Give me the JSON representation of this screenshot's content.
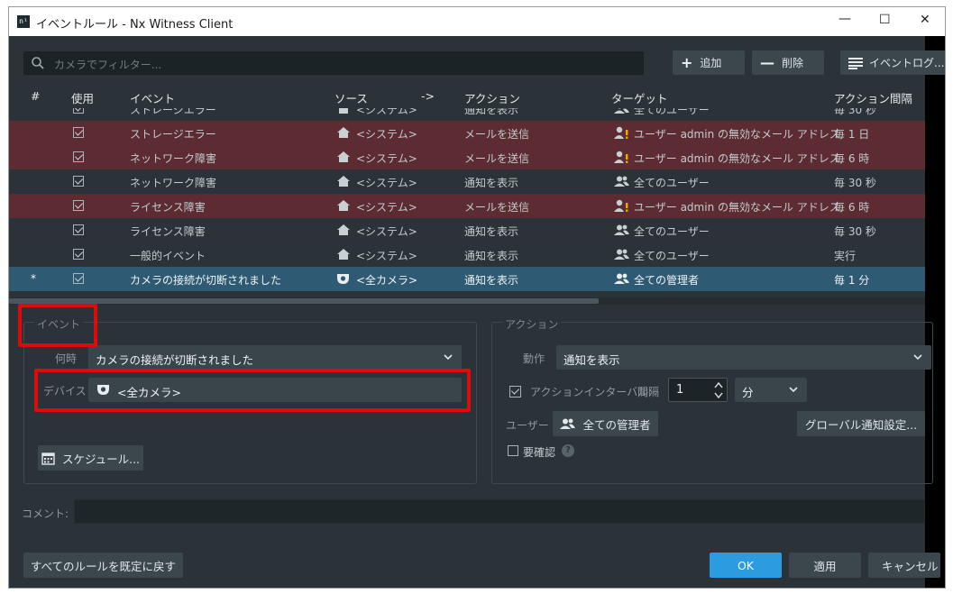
{
  "window": {
    "title": "イベントルール - Nx Witness Client",
    "app_icon": "n¹"
  },
  "toolbar": {
    "filter_placeholder": "カメラでフィルター...",
    "add_label": "追加",
    "delete_label": "削除",
    "eventlog_label": "イベントログ..."
  },
  "table": {
    "headers": {
      "num": "#",
      "use": "使用",
      "event": "イベント",
      "source": "ソース",
      "arrow": "->",
      "action": "アクション",
      "target": "ターゲット",
      "interval": "アクション間隔"
    },
    "rows": [
      {
        "mark": "",
        "event": "ストレージエラー",
        "source": "<システム>",
        "action": "通知を表示",
        "target": "全てのユーザー",
        "interval": "毎 30 秒",
        "state": "normal",
        "source_icon": "home-icon",
        "target_icon": "users-icon"
      },
      {
        "mark": "",
        "event": "ストレージエラー",
        "source": "<システム>",
        "action": "メールを送信",
        "target": "ユーザー admin の無効なメール アドレス",
        "interval": "毎 1 日",
        "state": "warn",
        "source_icon": "home-icon",
        "target_icon": "user-warning-icon"
      },
      {
        "mark": "",
        "event": "ネットワーク障害",
        "source": "<システム>",
        "action": "メールを送信",
        "target": "ユーザー admin の無効なメール アドレス",
        "interval": "毎 6 時",
        "state": "warn",
        "source_icon": "home-icon",
        "target_icon": "user-warning-icon"
      },
      {
        "mark": "",
        "event": "ネットワーク障害",
        "source": "<システム>",
        "action": "通知を表示",
        "target": "全てのユーザー",
        "interval": "毎 30 秒",
        "state": "normal",
        "source_icon": "home-icon",
        "target_icon": "users-icon"
      },
      {
        "mark": "",
        "event": "ライセンス障害",
        "source": "<システム>",
        "action": "メールを送信",
        "target": "ユーザー admin の無効なメール アドレス",
        "interval": "毎 6 時",
        "state": "warn",
        "source_icon": "home-icon",
        "target_icon": "user-warning-icon"
      },
      {
        "mark": "",
        "event": "ライセンス障害",
        "source": "<システム>",
        "action": "通知を表示",
        "target": "全てのユーザー",
        "interval": "毎 30 秒",
        "state": "normal",
        "source_icon": "home-icon",
        "target_icon": "users-icon"
      },
      {
        "mark": "",
        "event": "一般的イベント",
        "source": "<システム>",
        "action": "通知を表示",
        "target": "全てのユーザー",
        "interval": "実行",
        "state": "normal",
        "source_icon": "home-icon",
        "target_icon": "users-icon"
      },
      {
        "mark": "*",
        "event": "カメラの接続が切断されました",
        "source": "<全カメラ>",
        "action": "通知を表示",
        "target": "全ての管理者",
        "interval": "毎 1 分",
        "state": "selected",
        "source_icon": "camera-icon",
        "target_icon": "users-icon"
      }
    ]
  },
  "event_panel": {
    "group_label": "イベント",
    "when_label": "何時",
    "when_value": "カメラの接続が切断されました",
    "device_label": "デバイス",
    "device_value": "<全カメラ>",
    "schedule_label": "スケジュール..."
  },
  "action_panel": {
    "group_label": "アクション",
    "do_label": "動作",
    "do_value": "通知を表示",
    "interval_label": "アクションインターバル:",
    "every_label": "間隔",
    "interval_value": "1",
    "unit_value": "分",
    "user_label": "ユーザー",
    "user_value": "全ての管理者",
    "global_settings_label": "グローバル通知設定...",
    "ack_label": "要確認",
    "interval_checked": true,
    "ack_checked": false
  },
  "comment": {
    "label": "コメント:",
    "value": ""
  },
  "footer": {
    "reset_label": "すべてのルールを既定に戻す",
    "ok_label": "OK",
    "apply_label": "適用",
    "cancel_label": "キャンセル"
  },
  "colors": {
    "background": "#2b3338",
    "warning_row": "#5d2c32",
    "selected_row": "#2f5a73",
    "ok_button": "#2c9be0",
    "highlight": "#e10a0a"
  }
}
